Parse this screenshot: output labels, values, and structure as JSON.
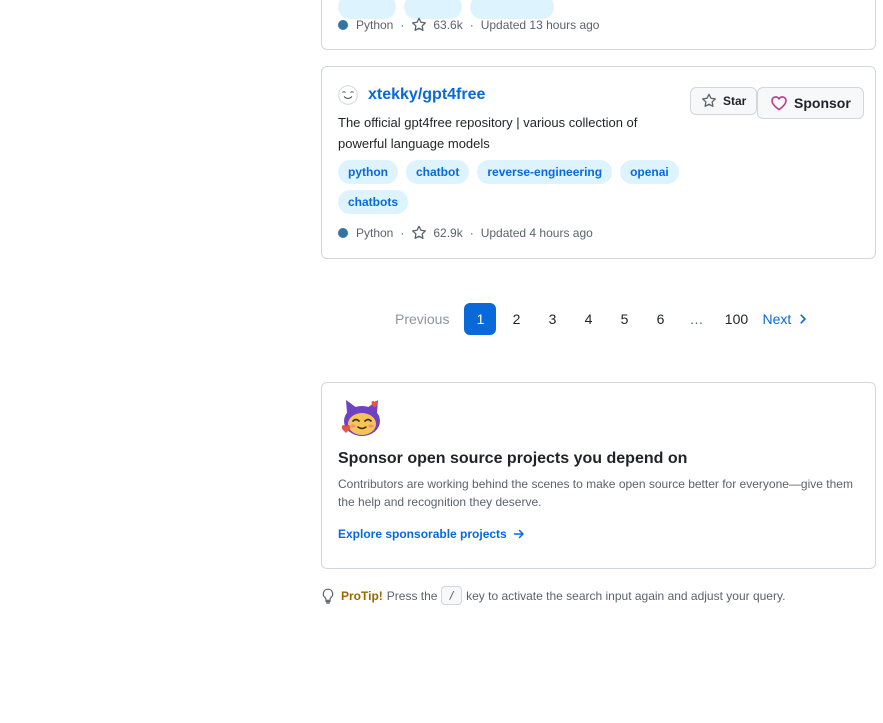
{
  "prev_result": {
    "language": "Python",
    "stars": "63.6k",
    "updated": "Updated 13 hours ago"
  },
  "repo": {
    "name": "xtekky/gpt4free",
    "description": "The official gpt4free repository | various collection of powerful language models",
    "topics": [
      "python",
      "chatbot",
      "reverse-engineering",
      "openai",
      "chatbots"
    ],
    "language": "Python",
    "stars": "62.9k",
    "updated": "Updated 4 hours ago",
    "star_label": "Star",
    "sponsor_label": "Sponsor"
  },
  "pagination": {
    "previous": "Previous",
    "pages": [
      "1",
      "2",
      "3",
      "4",
      "5",
      "6"
    ],
    "gap": "…",
    "last": "100",
    "next": "Next",
    "current": "1"
  },
  "sponsor_card": {
    "title": "Sponsor open source projects you depend on",
    "description": "Contributors are working behind the scenes to make open source better for everyone—give them the help and recognition they deserve.",
    "link": "Explore sponsorable projects"
  },
  "protip": {
    "label": "ProTip!",
    "text_before": "Press the",
    "key": "/",
    "text_after": "key to activate the search input again and adjust your query."
  },
  "colors": {
    "accent": "#0969da",
    "python": "#3572a5",
    "sponsor": "#bf3989"
  }
}
